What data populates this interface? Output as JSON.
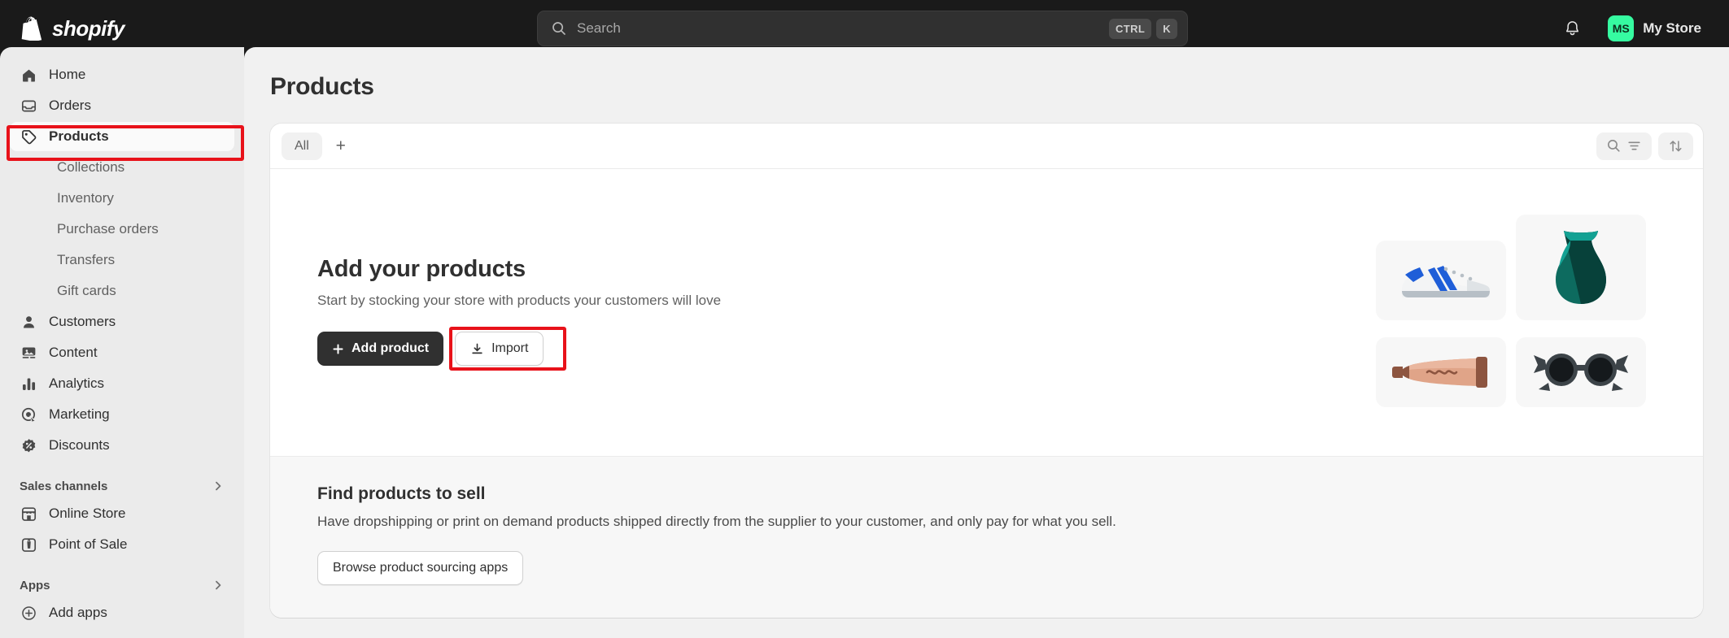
{
  "topbar": {
    "brand_name": "shopify",
    "brand_logo_icon": "shopify-bag-icon",
    "search": {
      "placeholder": "Search",
      "value": "",
      "icon": "search-icon",
      "shortcut_modifier": "CTRL",
      "shortcut_key": "K"
    },
    "notifications_icon": "bell-icon",
    "store": {
      "initials": "MS",
      "name": "My Store",
      "avatar_color": "#36fba1"
    }
  },
  "sidebar": {
    "items": [
      {
        "label": "Home",
        "icon": "home-icon",
        "active": false
      },
      {
        "label": "Orders",
        "icon": "orders-inbox-icon",
        "active": false
      },
      {
        "label": "Products",
        "icon": "product-tag-icon",
        "active": true
      }
    ],
    "product_subitems": [
      {
        "label": "Collections"
      },
      {
        "label": "Inventory"
      },
      {
        "label": "Purchase orders"
      },
      {
        "label": "Transfers"
      },
      {
        "label": "Gift cards"
      }
    ],
    "items_after": [
      {
        "label": "Customers",
        "icon": "person-icon"
      },
      {
        "label": "Content",
        "icon": "content-image-icon"
      },
      {
        "label": "Analytics",
        "icon": "bar-chart-icon"
      },
      {
        "label": "Marketing",
        "icon": "target-icon"
      },
      {
        "label": "Discounts",
        "icon": "discount-percent-icon"
      }
    ],
    "sales_channels": {
      "title": "Sales channels",
      "chevron_icon": "chevron-right-icon",
      "items": [
        {
          "label": "Online Store",
          "icon": "storefront-icon"
        },
        {
          "label": "Point of Sale",
          "icon": "point-of-sale-icon"
        }
      ]
    },
    "apps": {
      "title": "Apps",
      "chevron_icon": "chevron-right-icon",
      "items": [
        {
          "label": "Add apps",
          "icon": "plus-circle-icon"
        }
      ]
    }
  },
  "main": {
    "page_title": "Products",
    "tabs": [
      {
        "label": "All",
        "selected": true
      }
    ],
    "add_tab_label": "+",
    "search_filter_icon": "search-filter-icon",
    "sort_icon": "sort-arrows-icon",
    "empty_state": {
      "title": "Add your products",
      "subtitle": "Start by stocking your store with products your customers will love",
      "primary_button": "Add product",
      "primary_button_icon": "plus-icon",
      "secondary_button": "Import",
      "secondary_button_icon": "import-download-icon",
      "illustrations": [
        {
          "name": "sneaker-illustration"
        },
        {
          "name": "vase-illustration"
        },
        {
          "name": "cosmetic-tube-illustration"
        },
        {
          "name": "sunglasses-illustration"
        }
      ]
    },
    "find_products": {
      "title": "Find products to sell",
      "subtitle": "Have dropshipping or print on demand products shipped directly from the supplier to your customer, and only pay for what you sell.",
      "button": "Browse product sourcing apps"
    }
  },
  "annotations": {
    "highlight_color": "#e8121a",
    "targets": [
      "sidebar-item-products",
      "import-button"
    ]
  }
}
